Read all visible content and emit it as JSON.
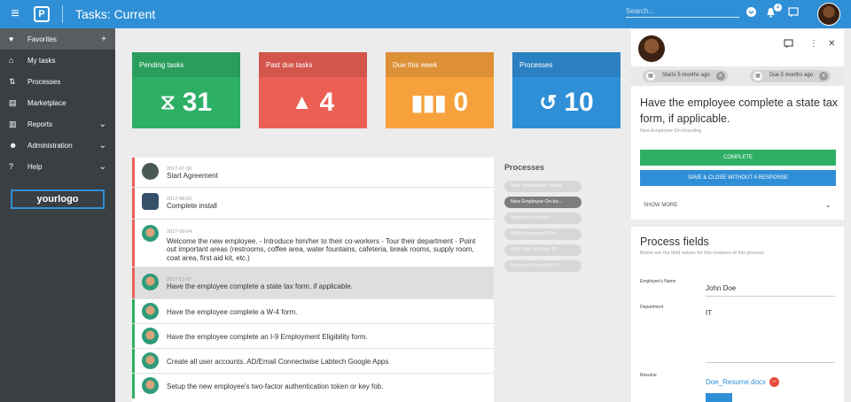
{
  "topbar": {
    "app_logo": "P",
    "title": "Tasks: Current",
    "search_placeholder": "Search...",
    "notif_count": "4"
  },
  "sidebar": {
    "items": [
      {
        "label": "Favorites",
        "icon": "heart-icon",
        "right": "+"
      },
      {
        "label": "My tasks",
        "icon": "home-icon",
        "right": ""
      },
      {
        "label": "Processes",
        "icon": "swap-icon",
        "right": ""
      },
      {
        "label": "Marketplace",
        "icon": "store-icon",
        "right": ""
      },
      {
        "label": "Reports",
        "icon": "chart-icon",
        "right": "⌄"
      },
      {
        "label": "Administration",
        "icon": "people-icon",
        "right": "⌄"
      },
      {
        "label": "Help",
        "icon": "help-icon",
        "right": "⌄"
      }
    ],
    "logo_text": "yourlogo"
  },
  "stats": [
    {
      "label": "Pending tasks",
      "value": "31",
      "color": "#2eaf66",
      "icon": "hourglass-icon"
    },
    {
      "label": "Past due tasks",
      "value": "4",
      "color": "#ec5f55",
      "icon": "warning-icon"
    },
    {
      "label": "Due this week",
      "value": "0",
      "color": "#f6a13b",
      "icon": "columns-icon"
    },
    {
      "label": "Processes",
      "value": "10",
      "color": "#2f8fd6",
      "icon": "history-icon"
    }
  ],
  "tasks": [
    {
      "date": "2017-07-30",
      "text": "Start Agreement"
    },
    {
      "date": "2017-08-02",
      "text": "Complete install"
    },
    {
      "date": "2017-08-04",
      "text": "Welcome the new employee. - Introduce him/her to their co-workers - Tour their department - Point out important areas (restrooms, coffee area, water fountains, cafeteria, break rooms, supply room, coat area, first aid kit, etc.)"
    },
    {
      "date": "2017-11-07",
      "text": "Have the employee complete a state tax form, if applicable."
    },
    {
      "date": "",
      "text": "Have the employee complete a W-4 form."
    },
    {
      "date": "",
      "text": "Have the employee complete an I-9 Employment Eligibility form."
    },
    {
      "date": "",
      "text": "Create all user accounts.  AD/Email Connectwise Labtech Google Apps"
    },
    {
      "date": "",
      "text": "Setup the new employee's two-factor authentication token or key fob."
    }
  ],
  "processes": {
    "title": "Processes",
    "items": [
      "New Workstation Install",
      "New Employee On-bo...",
      "Interview Process",
      "Billing Agreement Se...",
      "Add User to Active Di...",
      "Inclusive (Imported U..."
    ]
  },
  "detail": {
    "tag_start": "Starts 5 months ago",
    "tag_due": "Due 5 months ago",
    "title": "Have the employee complete a state tax form, if applicable.",
    "subtitle": "New Employee On-boarding",
    "complete_label": "COMPLETE",
    "save_close_label": "SAVE & CLOSE WITHOUT A RESPONSE",
    "show_more_label": "SHOW MORE"
  },
  "process_fields": {
    "title": "Process fields",
    "subtitle": "Below are the field values for this instance of this process",
    "fields": [
      {
        "label": "Employee's Name",
        "value": "John Doe"
      },
      {
        "label": "Department",
        "value": "IT"
      },
      {
        "label": "Resume",
        "value": "Doe_Resume.docx"
      }
    ]
  },
  "colors": {
    "accent": "#2f8fd6",
    "complete": "#2eaf66",
    "overdue_strip": "#ec5f55",
    "ok_strip": "#2eaf66"
  }
}
